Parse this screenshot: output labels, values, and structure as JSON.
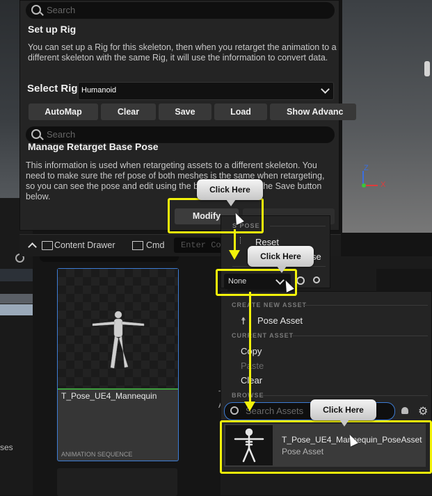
{
  "rig_panel": {
    "search_placeholder": "Search",
    "setup_title": "Set up Rig",
    "setup_description": "You can set up a Rig for this skeleton, then when you retarget the animation to a different skeleton with the same Rig, it will use the information to convert data.",
    "select_rig_label": "Select Rig",
    "select_rig_value": "Humanoid",
    "buttons": [
      "AutoMap",
      "Clear",
      "Save",
      "Load",
      "Show Advanc"
    ],
    "search2_placeholder": "Search",
    "base_pose_title": "Manage Retarget Base Pose",
    "base_pose_description": "This information is used when retargeting assets to a different skeleton. You need to make sure the ref pose of both meshes is the same when retargeting, so you can see the pose and edit using the b                    idget, and click the Save button below.",
    "modify_label": "Modify"
  },
  "viewport": {
    "axis_z": "Z",
    "axis_x": "X",
    "axis_z_color": "#3b6fe0",
    "axis_x_color": "#e03b3b",
    "axis_y_color": "#3bc43b"
  },
  "drawer_bar": {
    "content_drawer_label": "Content Drawer",
    "cmd_label": "Cmd",
    "cmd_placeholder": "Enter Co"
  },
  "asset_card": {
    "name": "T_Pose_UE4_Mannequin",
    "type": "ANIMATION SEQUENCE"
  },
  "left_strip": {
    "partial_text": "ses"
  },
  "partial_labels": {
    "t": "T",
    "a": "A"
  },
  "menu1": {
    "section": "S  POSE",
    "items": [
      "Reset",
      "se"
    ]
  },
  "none_select": {
    "value": "None"
  },
  "menu2": {
    "section_create": "CREATE NEW ASSET",
    "pose_asset_label": "Pose Asset",
    "section_current": "CURRENT ASSET",
    "copy_label": "Copy",
    "paste_label": "Paste",
    "clear_label": "Clear",
    "section_browse": "BROWSE",
    "search_placeholder": "Search Assets",
    "result": {
      "name": "T_Pose_UE4_Mannequin_PoseAsset",
      "type": "Pose Asset"
    }
  },
  "callouts": [
    "Click Here",
    "Click Here",
    "Click Here"
  ],
  "accent_colors": {
    "highlight": "#f2f20a",
    "selection": "#3d7dd6"
  }
}
